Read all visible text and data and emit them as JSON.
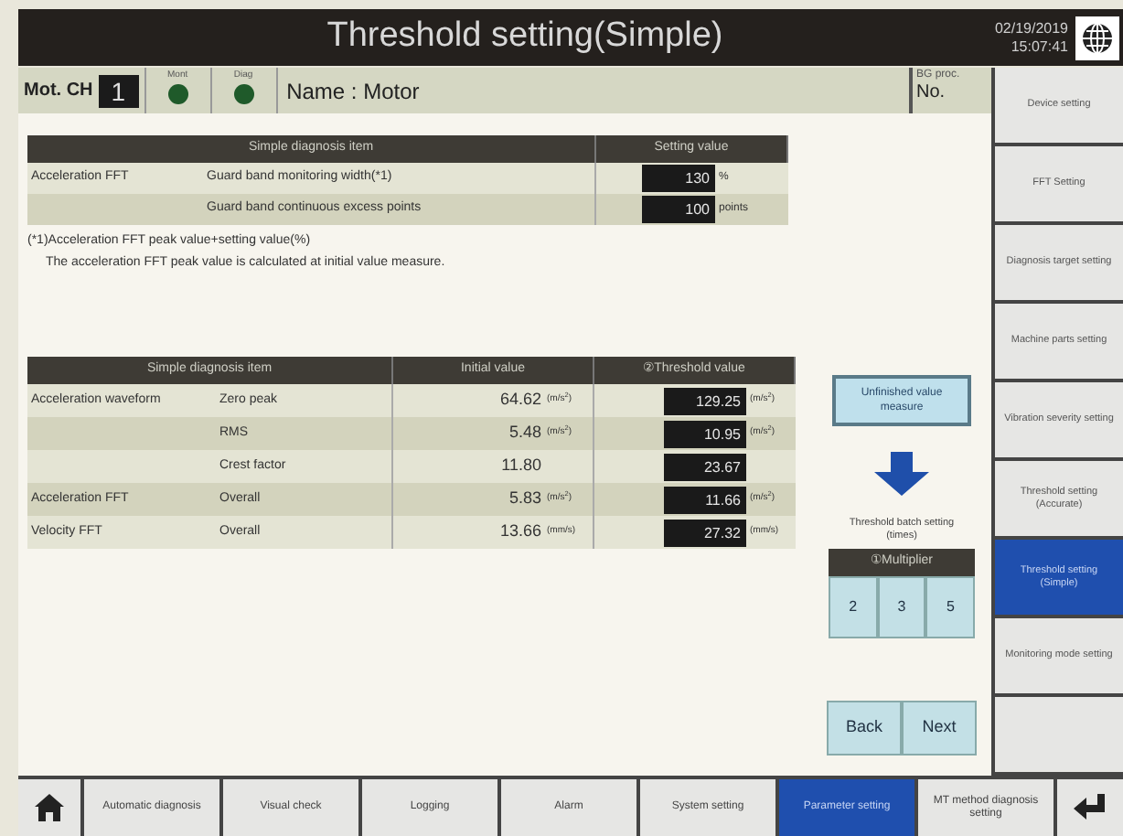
{
  "window": {
    "title": "Threshold setting(Simple)",
    "datetime": [
      "02/19/2019",
      "15:07:41"
    ]
  },
  "header": {
    "channel_label": "Mot. CH",
    "channel": "1",
    "leds": [
      {
        "label": "Mont",
        "lit": false
      },
      {
        "label": "Diag",
        "lit": false
      }
    ],
    "name": "Name : Motor",
    "bg_label": [
      "BG proc.",
      "No."
    ]
  },
  "setting_table": {
    "columns": [
      "Simple diagnosis item",
      "Setting value"
    ],
    "rows": [
      {
        "group": "Acceleration FFT",
        "item": "Guard band monitoring width(*1)",
        "value": "130",
        "unit": "%"
      },
      {
        "item": "Guard band continuous excess points",
        "value": "100",
        "unit": "points"
      }
    ],
    "notes": [
      "(*1)Acceleration FFT peak value+setting value(%)",
      "The acceleration FFT peak value is calculated at initial value measure."
    ]
  },
  "threshold_table": {
    "columns": [
      "Simple diagnosis item",
      "Initial value",
      "②Threshold value"
    ],
    "rows": [
      {
        "group": "Acceleration waveform",
        "item": "Zero peak",
        "initial": "64.62",
        "initial_unit": "(m/s$^{2}$)",
        "threshold": "129.25",
        "unit": "(m/s$^{2}$)"
      },
      {
        "item": "RMS",
        "initial": "5.48",
        "initial_unit": "(m/s$^{2}$)",
        "threshold": "10.95",
        "unit": "(m/s$^{2}$)"
      },
      {
        "item": "Crest factor",
        "initial": "11.80",
        "threshold": "23.67"
      },
      {
        "group": "Acceleration FFT",
        "item": "Overall",
        "initial": "5.83",
        "initial_unit": "(m/s$^{2}$)",
        "threshold": "11.66",
        "unit": "(m/s$^{2}$)"
      },
      {
        "group": "Velocity FFT",
        "item": "Overall",
        "initial": "13.66",
        "initial_unit": "(mm/s)",
        "threshold": "27.32",
        "unit": "(mm/s)"
      }
    ]
  },
  "side": {
    "measure_button": "Unfinished value measure",
    "batch_label": [
      "Threshold batch setting",
      "(times)"
    ],
    "multiplier_header": "①Multiplier",
    "multipliers": [
      "2",
      "3",
      "5"
    ],
    "nav_buttons": [
      "Back",
      "Next"
    ]
  },
  "side_menu": [
    {
      "label": "Device setting",
      "selected": false
    },
    {
      "label": "FFT Setting",
      "selected": false
    },
    {
      "label": "Diagnosis target setting",
      "selected": false
    },
    {
      "label": "Machine parts setting",
      "selected": false
    },
    {
      "label": "Vibration severity setting",
      "selected": false
    },
    {
      "label": "Threshold setting (Accurate)",
      "selected": false
    },
    {
      "label": "Threshold setting (Simple)",
      "selected": true
    },
    {
      "label": "Monitoring mode setting",
      "selected": false
    },
    {
      "selected": false
    }
  ],
  "bottom_bar": [
    {
      "kind": "home",
      "selected": false
    },
    {
      "kind": "text",
      "label": "Automatic diagnosis",
      "selected": false
    },
    {
      "kind": "text",
      "label": "Visual check",
      "selected": false
    },
    {
      "kind": "text",
      "label": "Logging",
      "selected": false
    },
    {
      "kind": "text",
      "label": "Alarm",
      "selected": false
    },
    {
      "kind": "text",
      "label": "System setting",
      "selected": false
    },
    {
      "kind": "text",
      "label": "Parameter setting",
      "selected": true
    },
    {
      "kind": "text",
      "label": "MT method diagnosis setting",
      "selected": false
    },
    {
      "kind": "return",
      "selected": false
    }
  ]
}
